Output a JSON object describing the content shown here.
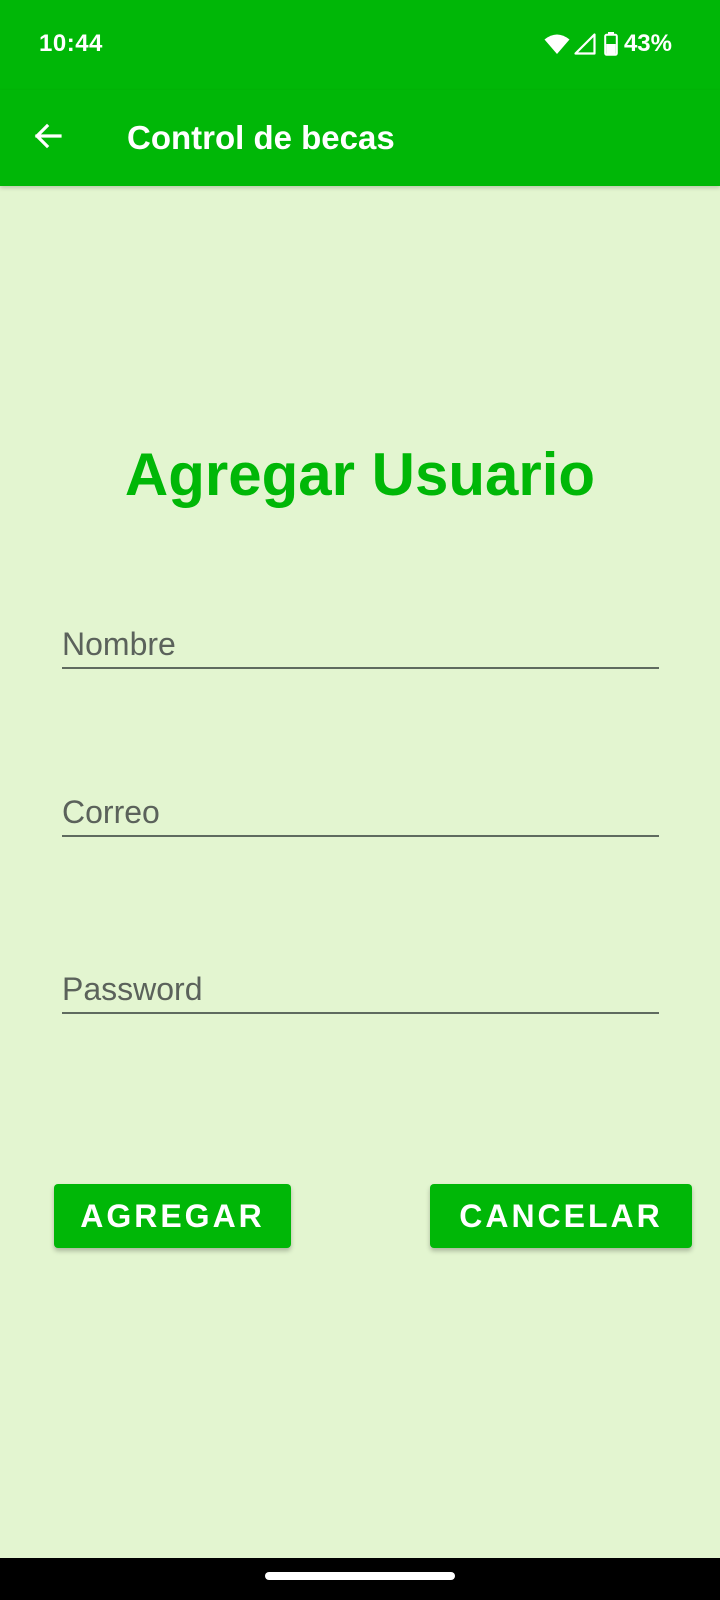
{
  "status_bar": {
    "time": "10:44",
    "battery_percent": "43%",
    "icons": [
      "wifi-icon",
      "signal-icon",
      "battery-icon"
    ]
  },
  "app_bar": {
    "title": "Control de becas",
    "back_icon": "arrow-left-icon"
  },
  "form": {
    "title": "Agregar Usuario",
    "fields": {
      "nombre": {
        "placeholder": "Nombre",
        "value": ""
      },
      "correo": {
        "placeholder": "Correo",
        "value": ""
      },
      "password": {
        "placeholder": "Password",
        "value": ""
      }
    },
    "buttons": {
      "agregar": "AGREGAR",
      "cancelar": "CANCELAR"
    }
  },
  "colors": {
    "accent": "#00b707",
    "background": "#e3f5d0",
    "field_text": "#5b625b",
    "button_text": "#ffffff"
  }
}
